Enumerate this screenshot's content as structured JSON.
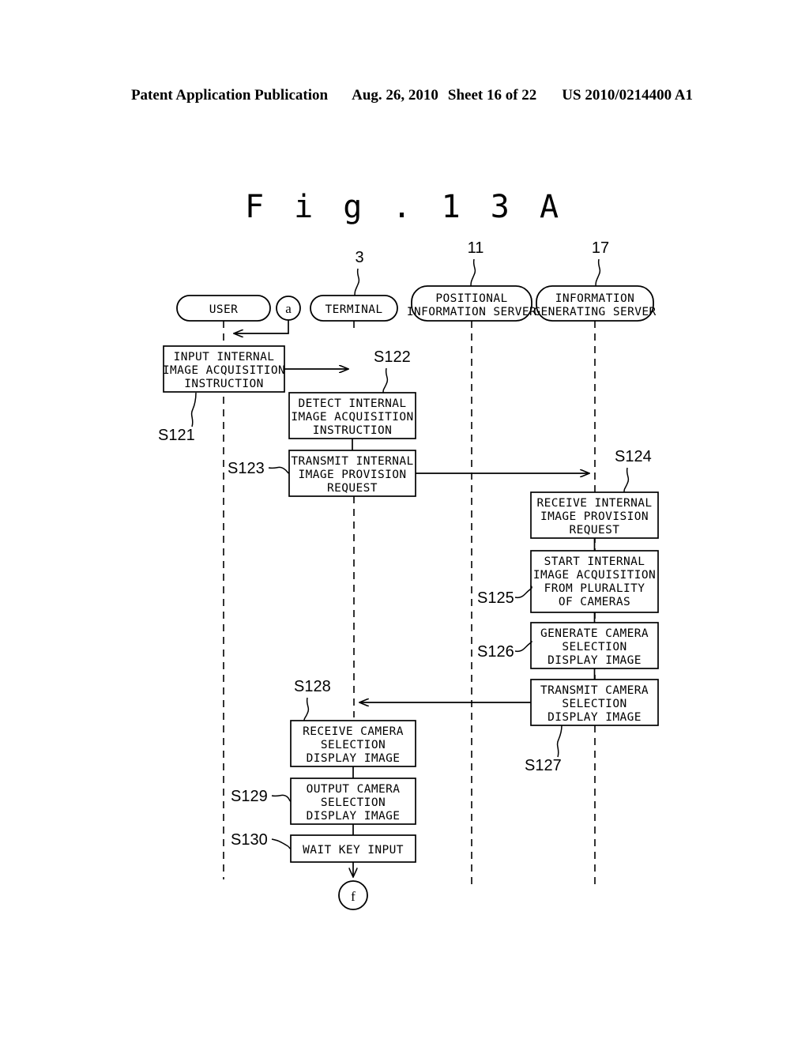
{
  "header": {
    "publication": "Patent Application Publication",
    "date": "Aug. 26, 2010",
    "sheet": "Sheet 16 of 22",
    "patent_number": "US 2010/0214400 A1"
  },
  "figure": {
    "title": "F i g . 1 3 A"
  },
  "lifelines": [
    {
      "id": "user",
      "label": "USER",
      "ref": ""
    },
    {
      "id": "terminal",
      "label": "TERMINAL",
      "ref": "3"
    },
    {
      "id": "positional-information-server",
      "label_line1": "POSITIONAL",
      "label_line2": "INFORMATION SERVER",
      "ref": "11"
    },
    {
      "id": "information-generating-server",
      "label_line1": "INFORMATION",
      "label_line2": "GENERATING SERVER",
      "ref": "17"
    }
  ],
  "connectors": {
    "entry": "a",
    "exit": "f"
  },
  "steps": [
    {
      "id": "S121",
      "label": "S121",
      "lane": "user",
      "lines": [
        "INPUT INTERNAL",
        "IMAGE ACQUISITION",
        "INSTRUCTION"
      ]
    },
    {
      "id": "S122",
      "label": "S122",
      "lane": "terminal",
      "lines": [
        "DETECT INTERNAL",
        "IMAGE ACQUISITION",
        "INSTRUCTION"
      ]
    },
    {
      "id": "S123",
      "label": "S123",
      "lane": "terminal",
      "lines": [
        "TRANSMIT INTERNAL",
        "IMAGE PROVISION",
        "REQUEST"
      ]
    },
    {
      "id": "S124",
      "label": "S124",
      "lane": "information-generating-server",
      "lines": [
        "RECEIVE INTERNAL",
        "IMAGE PROVISION",
        "REQUEST"
      ]
    },
    {
      "id": "S125",
      "label": "S125",
      "lane": "information-generating-server",
      "lines": [
        "START INTERNAL",
        "IMAGE ACQUISITION",
        "FROM PLURALITY",
        "OF CAMERAS"
      ]
    },
    {
      "id": "S126",
      "label": "S126",
      "lane": "information-generating-server",
      "lines": [
        "GENERATE CAMERA",
        "SELECTION",
        "DISPLAY IMAGE"
      ]
    },
    {
      "id": "S127",
      "label": "S127",
      "lane": "information-generating-server",
      "lines": [
        "TRANSMIT CAMERA",
        "SELECTION",
        "DISPLAY IMAGE"
      ]
    },
    {
      "id": "S128",
      "label": "S128",
      "lane": "terminal",
      "lines": [
        "RECEIVE CAMERA",
        "SELECTION",
        "DISPLAY IMAGE"
      ]
    },
    {
      "id": "S129",
      "label": "S129",
      "lane": "terminal",
      "lines": [
        "OUTPUT CAMERA",
        "SELECTION",
        "DISPLAY IMAGE"
      ]
    },
    {
      "id": "S130",
      "label": "S130",
      "lane": "terminal",
      "lines": [
        "WAIT KEY INPUT"
      ]
    }
  ],
  "colors": {
    "ink": "#000000",
    "paper": "#ffffff"
  }
}
